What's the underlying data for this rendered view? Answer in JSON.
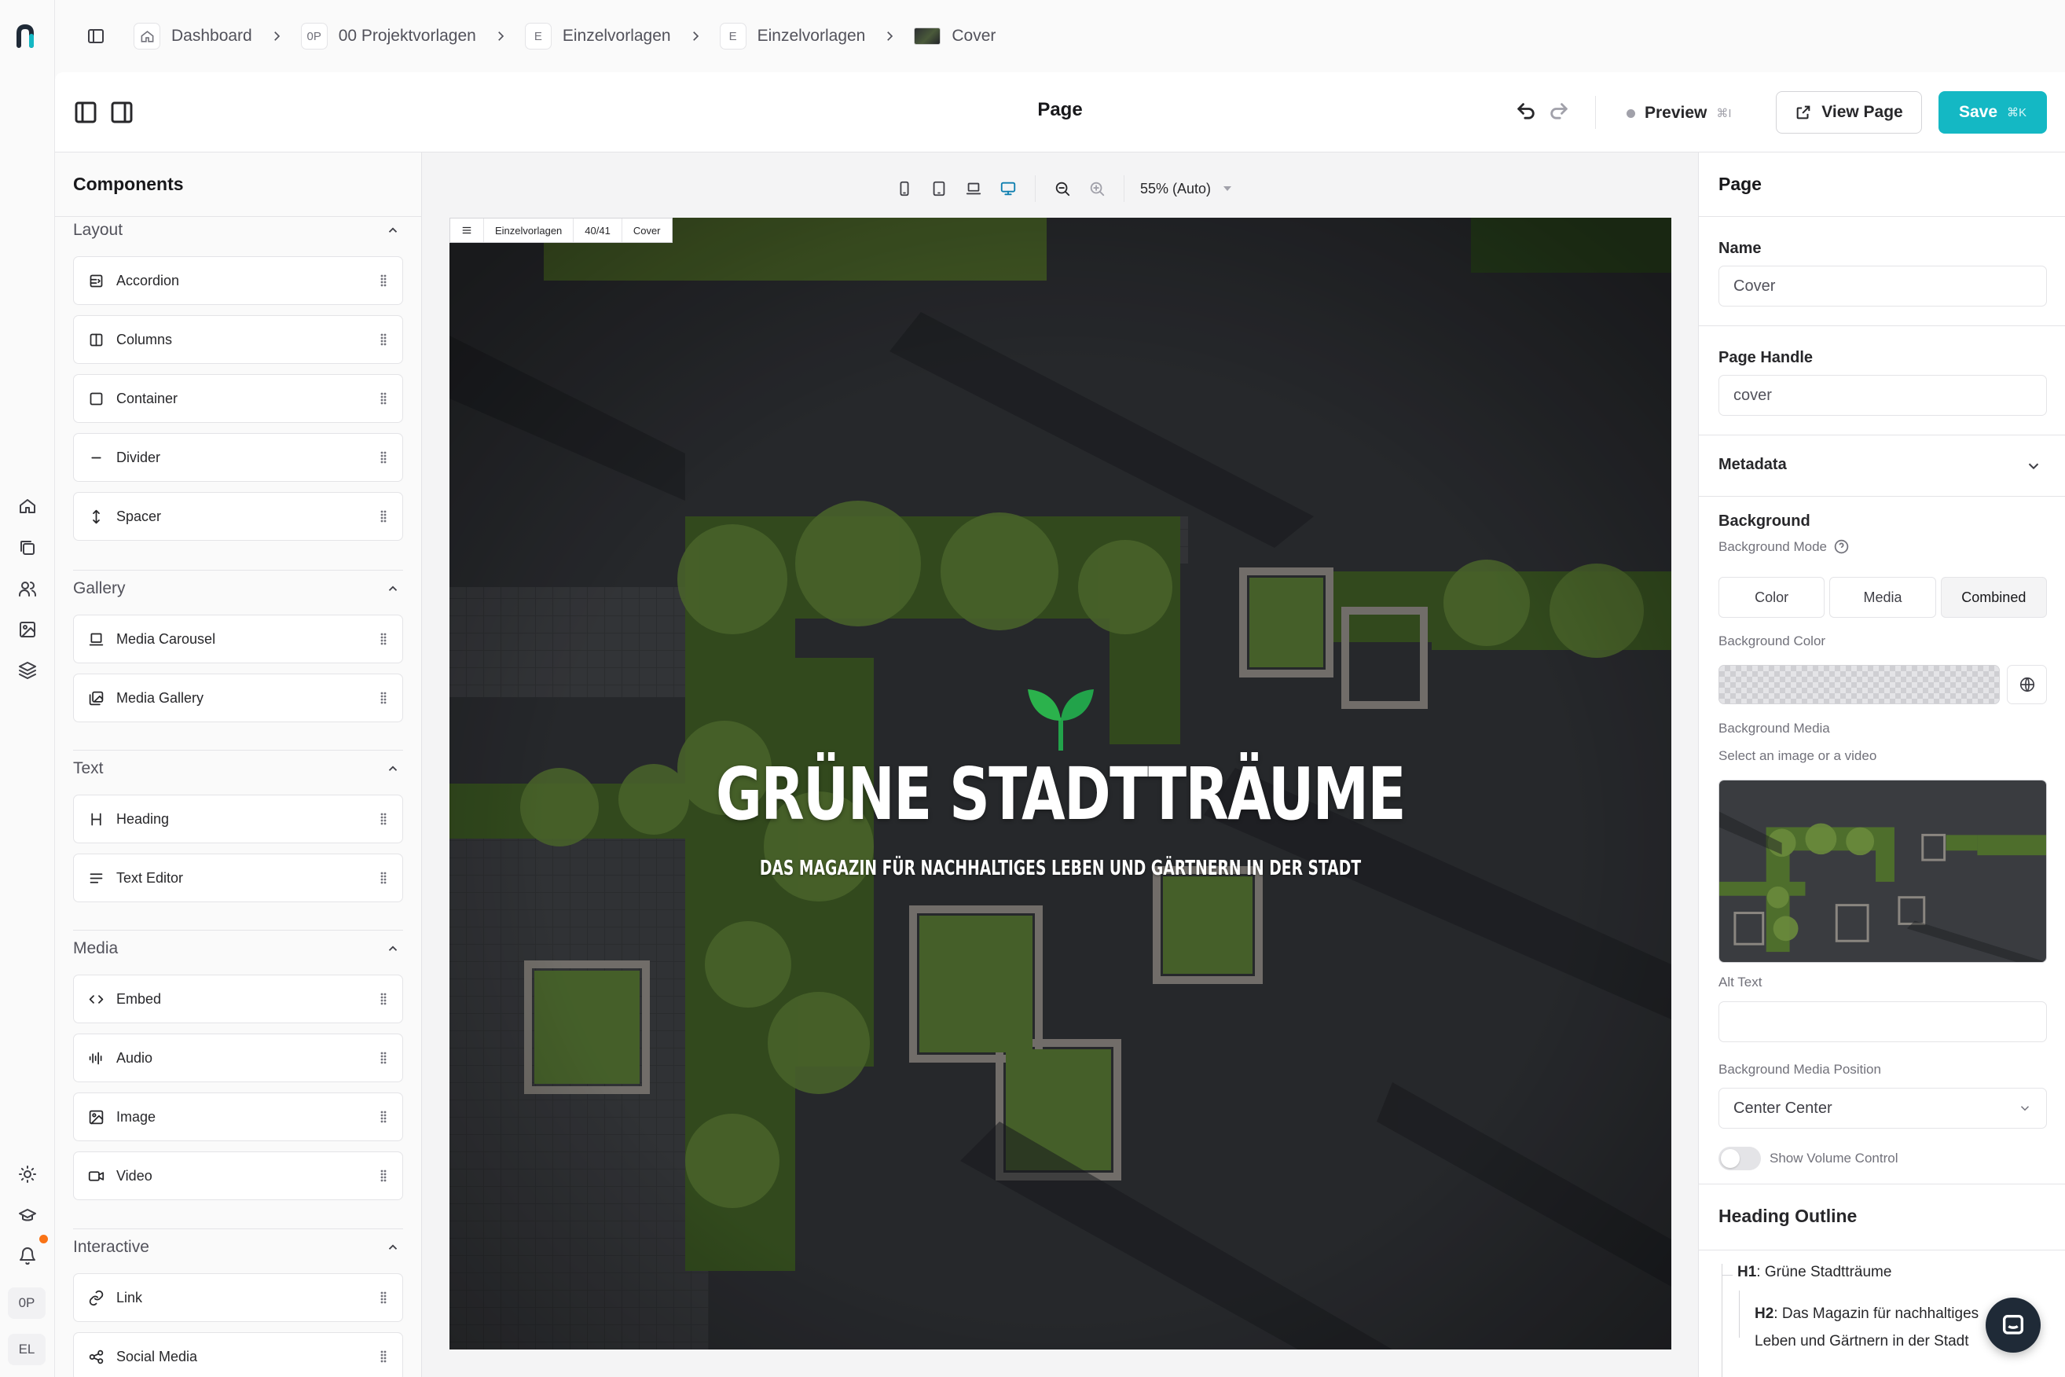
{
  "breadcrumb": {
    "items": [
      {
        "badge": "",
        "label": "Dashboard"
      },
      {
        "badge": "0P",
        "label": "00 Projektvorlagen"
      },
      {
        "badge": "E",
        "label": "Einzelvorlagen"
      },
      {
        "badge": "E",
        "label": "Einzelvorlagen"
      },
      {
        "badge": "",
        "label": "Cover"
      }
    ]
  },
  "rail": {
    "chips": [
      "0P",
      "EL"
    ]
  },
  "toolbar": {
    "title": "Page",
    "preview_label": "Preview",
    "preview_shortcut": "⌘I",
    "view_label": "View Page",
    "save_label": "Save",
    "save_shortcut": "⌘K",
    "accent_color": "#14b8c4"
  },
  "components": {
    "title": "Components",
    "sections": [
      {
        "title": "Layout",
        "items": [
          {
            "label": "Accordion",
            "icon": "accordion-icon"
          },
          {
            "label": "Columns",
            "icon": "columns-icon"
          },
          {
            "label": "Container",
            "icon": "container-icon"
          },
          {
            "label": "Divider",
            "icon": "divider-icon"
          },
          {
            "label": "Spacer",
            "icon": "spacer-icon"
          }
        ]
      },
      {
        "title": "Gallery",
        "items": [
          {
            "label": "Media Carousel",
            "icon": "carousel-icon"
          },
          {
            "label": "Media Gallery",
            "icon": "gallery-icon"
          }
        ]
      },
      {
        "title": "Text",
        "items": [
          {
            "label": "Heading",
            "icon": "heading-icon"
          },
          {
            "label": "Text Editor",
            "icon": "text-editor-icon"
          }
        ]
      },
      {
        "title": "Media",
        "items": [
          {
            "label": "Embed",
            "icon": "embed-icon"
          },
          {
            "label": "Audio",
            "icon": "audio-icon"
          },
          {
            "label": "Image",
            "icon": "image-icon"
          },
          {
            "label": "Video",
            "icon": "video-icon"
          }
        ]
      },
      {
        "title": "Interactive",
        "items": [
          {
            "label": "Link",
            "icon": "link-icon"
          },
          {
            "label": "Social Media",
            "icon": "social-media-icon"
          }
        ]
      }
    ]
  },
  "canvas": {
    "zoom_label": "55% (Auto)",
    "frame_tag": {
      "collection": "Einzelvorlagen",
      "counter": "40/41",
      "page": "Cover"
    },
    "hero_title": "GRÜNE STADTTRÄUME",
    "hero_subtitle": "DAS MAGAZIN FÜR NACHHALTIGES LEBEN UND GÄRTNERN IN DER STADT"
  },
  "page_settings": {
    "title": "Page",
    "name_label": "Name",
    "name_value": "Cover",
    "handle_label": "Page Handle",
    "handle_value": "cover",
    "metadata_label": "Metadata",
    "background_label": "Background",
    "background_mode_label": "Background Mode",
    "background_modes": [
      "Color",
      "Media",
      "Combined"
    ],
    "background_mode_selected": "Combined",
    "background_color_label": "Background Color",
    "background_media_label": "Background Media",
    "background_media_hint": "Select an image or a video",
    "alt_text_label": "Alt Text",
    "alt_text_value": "",
    "media_position_label": "Background Media Position",
    "media_position_value": "Center Center",
    "volume_label": "Show Volume Control",
    "volume_on": false
  },
  "heading_outline": {
    "title": "Heading Outline",
    "h1_tag": "H1",
    "h1_text": ": Grüne Stadtträume",
    "h2_tag": "H2",
    "h2_text": ": Das Magazin für nachhaltiges Leben und Gärtnern in der Stadt"
  }
}
